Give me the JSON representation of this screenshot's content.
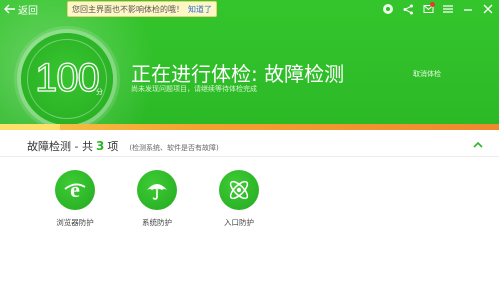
{
  "topbar": {
    "back_label": "返回",
    "notice_text": "您回主界面也不影响体检的哦！",
    "notice_link": "知道了"
  },
  "score": {
    "value": "100",
    "unit": "分"
  },
  "status": {
    "title": "正在进行体检: 故障检测",
    "subtitle": "尚未发现问题项目，请继续等待体检完成",
    "cancel_label": "取消体检"
  },
  "section": {
    "title": "故障检测 - 共",
    "count": "3",
    "unit": "项",
    "description": "(检测系统、软件是否有故障)"
  },
  "tiles": [
    {
      "label": "浏览器防护",
      "icon": "ie-icon"
    },
    {
      "label": "系统防护",
      "icon": "umbrella-icon"
    },
    {
      "label": "入口防护",
      "icon": "atom-icon"
    }
  ],
  "colors": {
    "brand_green": "#2fbe29",
    "progress_orange": "#f4a12f"
  }
}
